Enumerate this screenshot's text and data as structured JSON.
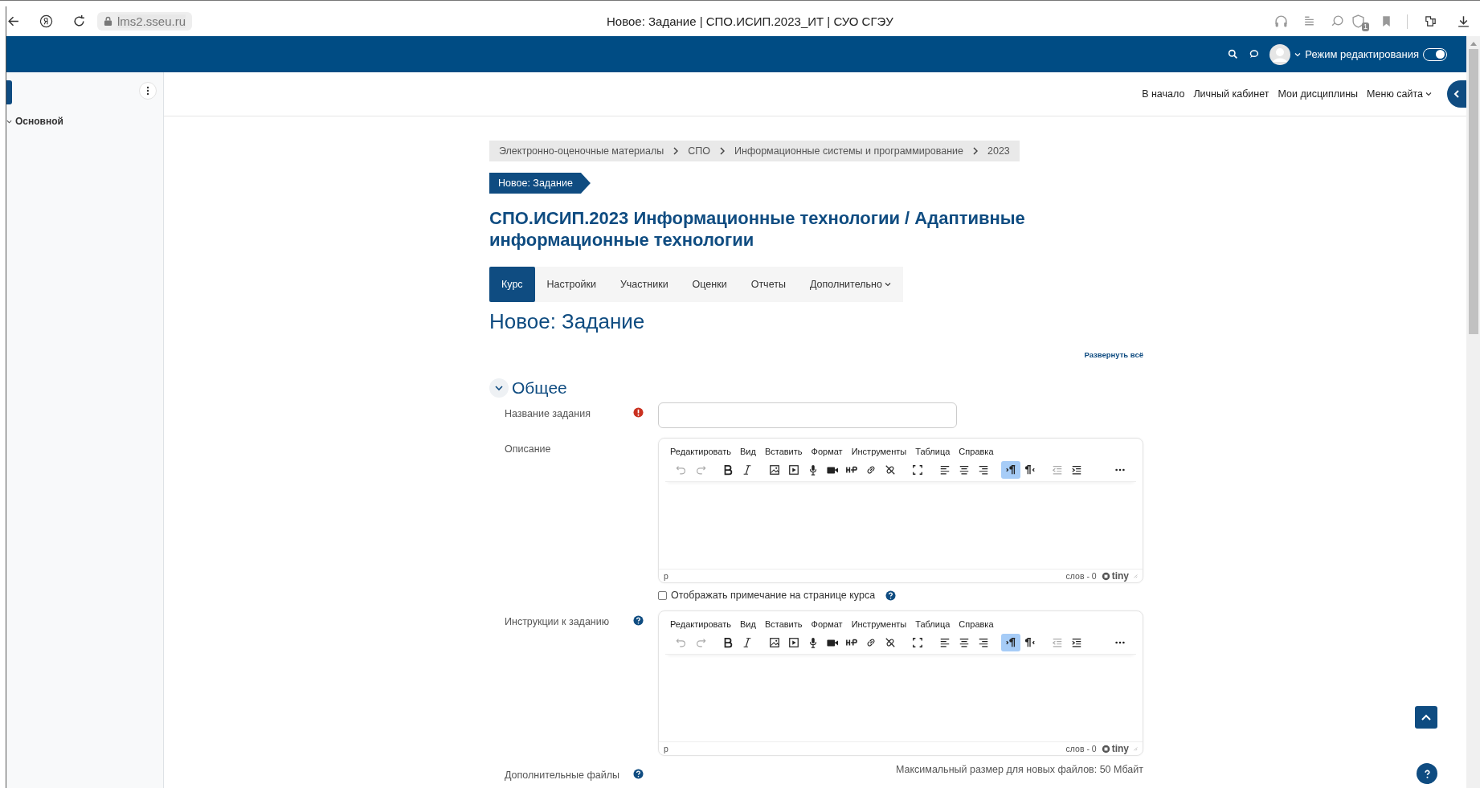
{
  "browser": {
    "address": "lms2.sseu.ru",
    "title": "Новое: Задание | СПО.ИСИП.2023_ИТ | СУО СГЭУ",
    "extension_badge": "1"
  },
  "navbar": {
    "edit_mode": {
      "label": "Режим редактирования",
      "on": true
    }
  },
  "drawer": {
    "items": [
      {
        "label": "Основной",
        "expanded": true
      }
    ]
  },
  "secondary_nav": [
    {
      "label": "В начало",
      "dropdown": false
    },
    {
      "label": "Личный кабинет",
      "dropdown": false
    },
    {
      "label": "Мои дисциплины",
      "dropdown": false
    },
    {
      "label": "Меню сайта",
      "dropdown": true
    }
  ],
  "breadcrumb": [
    "Электронно-оценочные материалы",
    "СПО",
    "Информационные системы и программирование",
    "2023"
  ],
  "page_badge": "Новое: Задание",
  "course_title": "СПО.ИСИП.2023 Информационные технологии / Адаптивные информационные технологии",
  "tabs": [
    {
      "label": "Курс",
      "selected": true,
      "dropdown": false
    },
    {
      "label": "Настройки",
      "selected": false,
      "dropdown": false
    },
    {
      "label": "Участники",
      "selected": false,
      "dropdown": false
    },
    {
      "label": "Оценки",
      "selected": false,
      "dropdown": false
    },
    {
      "label": "Отчеты",
      "selected": false,
      "dropdown": false
    },
    {
      "label": "Дополнительно",
      "selected": false,
      "dropdown": true
    }
  ],
  "heading": "Новое: Задание",
  "expand_all": "Развернуть всё",
  "section": {
    "title": "Общее",
    "expanded": true
  },
  "fields": [
    {
      "kind": "text",
      "label": "Название задания",
      "required": true,
      "help": false
    },
    {
      "kind": "editor",
      "label": "Описание",
      "required": false,
      "help": false,
      "menu": [
        "Редактировать",
        "Вид",
        "Вставить",
        "Формат",
        "Инструменты",
        "Таблица",
        "Справка"
      ],
      "toolbar": [
        [
          {
            "kind": "undo",
            "disabled": true,
            "selected": false
          },
          {
            "kind": "redo",
            "disabled": true,
            "selected": false
          }
        ],
        [
          {
            "kind": "bold",
            "disabled": false,
            "selected": false
          },
          {
            "kind": "italic",
            "disabled": false,
            "selected": false
          }
        ],
        [
          {
            "kind": "image",
            "disabled": false,
            "selected": false
          },
          {
            "kind": "media",
            "disabled": false,
            "selected": false
          },
          {
            "kind": "mic",
            "disabled": false,
            "selected": false
          },
          {
            "kind": "video",
            "disabled": false,
            "selected": false
          },
          {
            "kind": "h5p",
            "disabled": false,
            "selected": false
          },
          {
            "kind": "link",
            "disabled": false,
            "selected": false
          },
          {
            "kind": "unlink",
            "disabled": false,
            "selected": false
          }
        ],
        [
          {
            "kind": "fullscreen",
            "disabled": false,
            "selected": false
          }
        ],
        [
          {
            "kind": "align-left",
            "disabled": false,
            "selected": false
          },
          {
            "kind": "align-center",
            "disabled": false,
            "selected": false
          },
          {
            "kind": "align-right",
            "disabled": false,
            "selected": false
          }
        ],
        [
          {
            "kind": "ltr",
            "disabled": false,
            "selected": true
          },
          {
            "kind": "rtl",
            "disabled": false,
            "selected": false
          }
        ],
        [
          {
            "kind": "outdent",
            "disabled": true,
            "selected": false
          },
          {
            "kind": "indent",
            "disabled": false,
            "selected": false
          }
        ],
        [
          {
            "kind": "more",
            "disabled": false,
            "selected": false
          }
        ]
      ],
      "path": "p",
      "word_count": "слов - 0",
      "brand": "tiny"
    },
    {
      "kind": "checkbox",
      "label": "Отображать примечание на странице курса",
      "checked": false,
      "help": true
    },
    {
      "kind": "editor",
      "label": "Инструкции к заданию",
      "required": false,
      "help": true,
      "menu": [
        "Редактировать",
        "Вид",
        "Вставить",
        "Формат",
        "Инструменты",
        "Таблица",
        "Справка"
      ],
      "toolbar": [
        [
          {
            "kind": "undo",
            "disabled": true,
            "selected": false
          },
          {
            "kind": "redo",
            "disabled": true,
            "selected": false
          }
        ],
        [
          {
            "kind": "bold",
            "disabled": false,
            "selected": false
          },
          {
            "kind": "italic",
            "disabled": false,
            "selected": false
          }
        ],
        [
          {
            "kind": "image",
            "disabled": false,
            "selected": false
          },
          {
            "kind": "media",
            "disabled": false,
            "selected": false
          },
          {
            "kind": "mic",
            "disabled": false,
            "selected": false
          },
          {
            "kind": "video",
            "disabled": false,
            "selected": false
          },
          {
            "kind": "h5p",
            "disabled": false,
            "selected": false
          },
          {
            "kind": "link",
            "disabled": false,
            "selected": false
          },
          {
            "kind": "unlink",
            "disabled": false,
            "selected": false
          }
        ],
        [
          {
            "kind": "fullscreen",
            "disabled": false,
            "selected": false
          }
        ],
        [
          {
            "kind": "align-left",
            "disabled": false,
            "selected": false
          },
          {
            "kind": "align-center",
            "disabled": false,
            "selected": false
          },
          {
            "kind": "align-right",
            "disabled": false,
            "selected": false
          }
        ],
        [
          {
            "kind": "ltr",
            "disabled": false,
            "selected": true
          },
          {
            "kind": "rtl",
            "disabled": false,
            "selected": false
          }
        ],
        [
          {
            "kind": "outdent",
            "disabled": true,
            "selected": false
          },
          {
            "kind": "indent",
            "disabled": false,
            "selected": false
          }
        ],
        [
          {
            "kind": "more",
            "disabled": false,
            "selected": false
          }
        ]
      ],
      "path": "p",
      "word_count": "слов - 0",
      "brand": "tiny"
    },
    {
      "kind": "files",
      "label": "Дополнительные файлы",
      "required": false,
      "help": true,
      "note": "Максимальный размер для новых файлов: 50 Мбайт"
    }
  ]
}
